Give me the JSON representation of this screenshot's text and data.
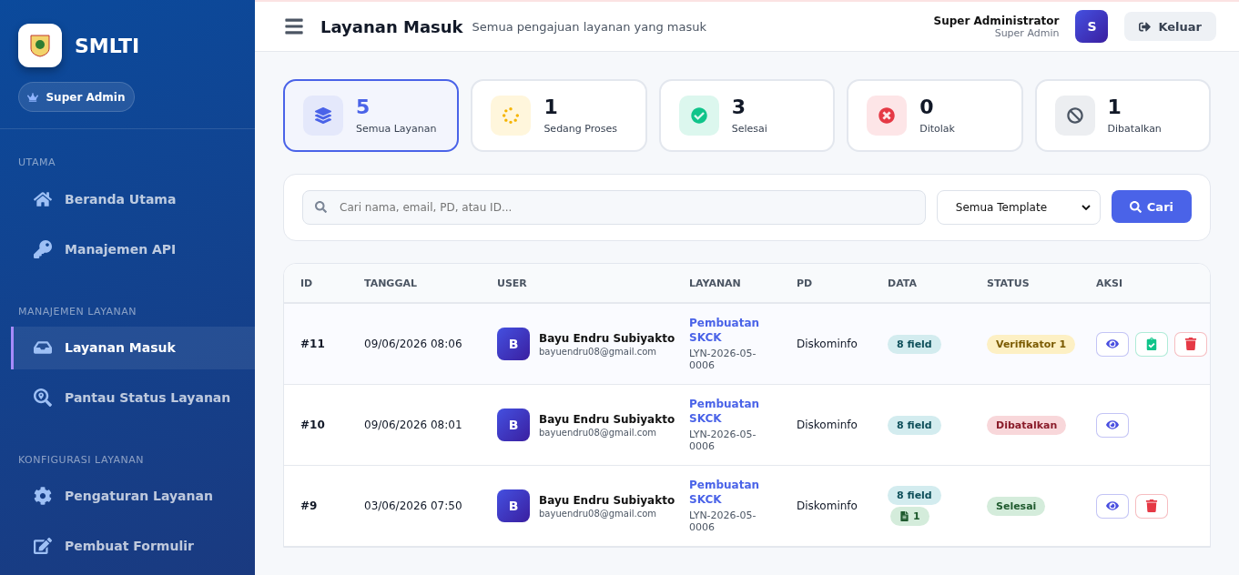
{
  "sidebar": {
    "brand": "SMLTI",
    "role": "Super Admin",
    "sections": [
      {
        "title": "UTAMA",
        "items": [
          {
            "label": "Beranda Utama",
            "selected": false
          },
          {
            "label": "Manajemen API",
            "selected": false
          }
        ]
      },
      {
        "title": "MANAJEMEN LAYANAN",
        "items": [
          {
            "label": "Layanan Masuk",
            "selected": true
          },
          {
            "label": "Pantau Status Layanan",
            "selected": false
          }
        ]
      },
      {
        "title": "KONFIGURASI LAYANAN",
        "items": [
          {
            "label": "Pengaturan Layanan",
            "selected": false
          },
          {
            "label": "Pembuat Formulir",
            "selected": false
          }
        ]
      }
    ]
  },
  "header": {
    "title": "Layanan Masuk",
    "subtitle": "Semua pengajuan layanan yang masuk",
    "user_name": "Super Administrator",
    "user_role": "Super Admin",
    "avatar": "S",
    "logout": "Keluar"
  },
  "stats": [
    {
      "kind": "all",
      "value": "5",
      "label": "Semua Layanan",
      "selected": true
    },
    {
      "kind": "process",
      "value": "1",
      "label": "Sedang Proses",
      "selected": false
    },
    {
      "kind": "done",
      "value": "3",
      "label": "Selesai",
      "selected": false
    },
    {
      "kind": "rejected",
      "value": "0",
      "label": "Ditolak",
      "selected": false
    },
    {
      "kind": "cancelled",
      "value": "1",
      "label": "Dibatalkan",
      "selected": false
    }
  ],
  "filter": {
    "placeholder": "Cari nama, email, PD, atau ID...",
    "template": "Semua Template",
    "button": "Cari"
  },
  "table": {
    "columns": [
      "ID",
      "TANGGAL",
      "USER",
      "LAYANAN",
      "PD",
      "DATA",
      "STATUS",
      "AKSI"
    ],
    "rows": [
      {
        "id": "#11",
        "date": "09/06/2026 08:06",
        "avatar": "B",
        "name": "Bayu Endru Subiyakto",
        "email": "bayuendru08@gmail.com",
        "service": "Pembuatan SKCK",
        "code": "LYN-2026-05-0006",
        "pd": "Diskominfo",
        "fields": "8 field",
        "status": {
          "kind": "pending",
          "label": "Verifikator 1"
        },
        "actions": [
          {
            "kind": "view"
          },
          {
            "kind": "verify"
          },
          {
            "kind": "delete"
          }
        ]
      },
      {
        "id": "#10",
        "date": "09/06/2026 08:01",
        "avatar": "B",
        "name": "Bayu Endru Subiyakto",
        "email": "bayuendru08@gmail.com",
        "service": "Pembuatan SKCK",
        "code": "LYN-2026-05-0006",
        "pd": "Diskominfo",
        "fields": "8 field",
        "status": {
          "kind": "cancelled",
          "label": "Dibatalkan"
        },
        "actions": [
          {
            "kind": "view"
          }
        ]
      },
      {
        "id": "#9",
        "date": "03/06/2026 07:50",
        "avatar": "B",
        "name": "Bayu Endru Subiyakto",
        "email": "bayuendru08@gmail.com",
        "service": "Pembuatan SKCK",
        "code": "LYN-2026-05-0006",
        "pd": "Diskominfo",
        "fields": "8 field",
        "files": "1",
        "status": {
          "kind": "done",
          "label": "Selesai"
        },
        "actions": [
          {
            "kind": "view"
          },
          {
            "kind": "delete"
          }
        ]
      }
    ]
  }
}
